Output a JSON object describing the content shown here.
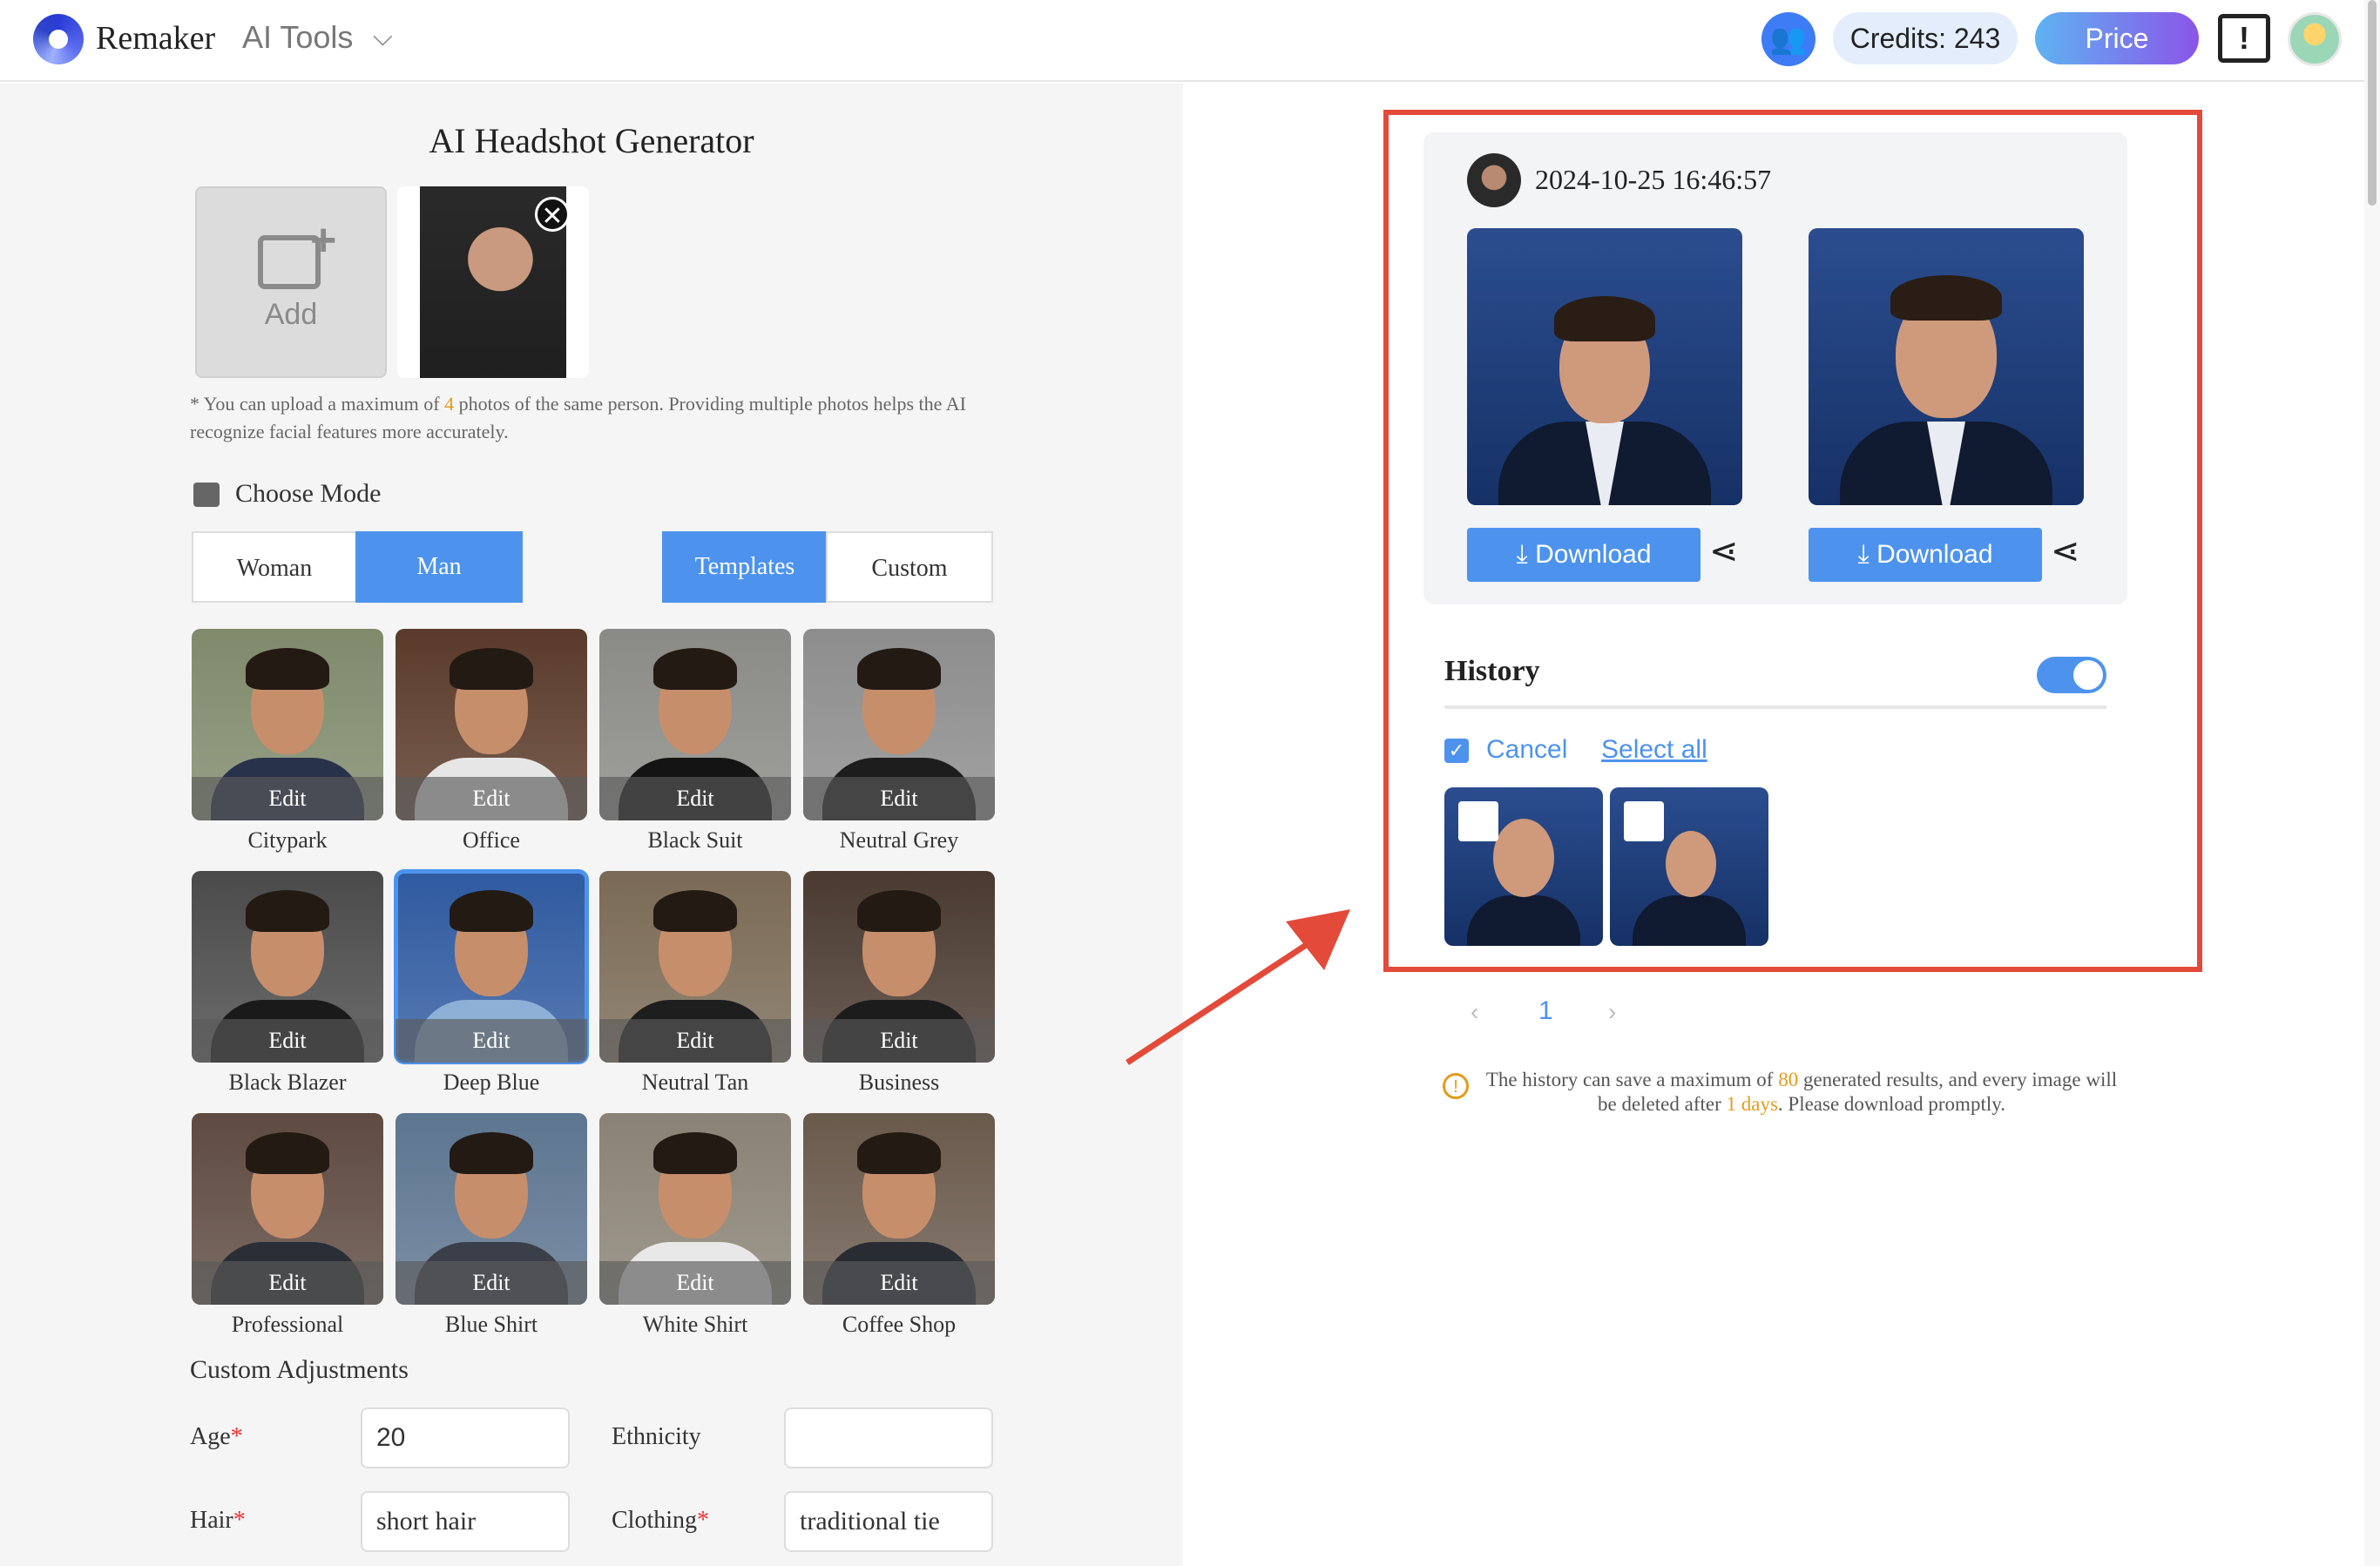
{
  "header": {
    "brand": "Remaker",
    "menu_label": "AI Tools",
    "chevron": "⌵",
    "credits": "Credits: 243",
    "price_label": "Price",
    "feedback_glyph": "!",
    "community_glyph": "👥"
  },
  "generator": {
    "title": "AI Headshot Generator",
    "add_label": "Add",
    "remove_glyph": "✕",
    "hint_prefix": "* You can upload a maximum of ",
    "hint_count": "4",
    "hint_suffix": " photos of the same person. Providing multiple photos helps the AI recognize facial features more accurately.",
    "mode_label": "Choose Mode",
    "gender": {
      "woman": "Woman",
      "man": "Man",
      "selected": "Man"
    },
    "style_tabs": {
      "templates": "Templates",
      "custom": "Custom",
      "selected": "Templates"
    },
    "edit_label": "Edit",
    "templates": [
      {
        "name": "Citypark",
        "bg": "#7f8a6b",
        "suit": "#28324a"
      },
      {
        "name": "Office",
        "bg": "#5a3a2a",
        "suit": "#e6e6e6"
      },
      {
        "name": "Black Suit",
        "bg": "#8a8a86",
        "suit": "#141414"
      },
      {
        "name": "Neutral Grey",
        "bg": "#8d8d8d",
        "suit": "#1d1d1d"
      },
      {
        "name": "Black Blazer",
        "bg": "#4a4a4a",
        "suit": "#1a1a1a"
      },
      {
        "name": "Deep Blue",
        "bg": "#2f5aa0",
        "suit": "#8eb0d6"
      },
      {
        "name": "Neutral Tan",
        "bg": "#7a6a55",
        "suit": "#1e1e1e"
      },
      {
        "name": "Business",
        "bg": "#4a3a30",
        "suit": "#1c1c1c"
      },
      {
        "name": "Professional",
        "bg": "#5e4a40",
        "suit": "#2a2e36"
      },
      {
        "name": "Blue Shirt",
        "bg": "#5d7590",
        "suit": "#3a3f4a"
      },
      {
        "name": "White Shirt",
        "bg": "#8a8274",
        "suit": "#e8e8e8"
      },
      {
        "name": "Coffee Shop",
        "bg": "#6a5a4c",
        "suit": "#2a2c34"
      }
    ],
    "selected_template": "Deep Blue",
    "adjustments_title": "Custom Adjustments",
    "fields": {
      "age_label": "Age",
      "age_value": "20",
      "ethnicity_label": "Ethnicity",
      "ethnicity_value": "",
      "hair_label": "Hair",
      "hair_value": "short hair",
      "clothing_label": "Clothing",
      "clothing_value": "traditional tie",
      "required_mark": "*"
    }
  },
  "result": {
    "timestamp": "2024-10-25 16:46:57",
    "download_label": "Download",
    "download_glyph": "⤓",
    "share_glyph": "⋖"
  },
  "history": {
    "title": "History",
    "toggle_on": true,
    "check_glyph": "✓",
    "cancel_label": "Cancel",
    "select_all_label": "Select all",
    "thumb_count": 2
  },
  "pagination": {
    "prev": "‹",
    "page": "1",
    "next": "›"
  },
  "notice": {
    "icon": "!",
    "prefix": "The history can save a maximum of ",
    "max_results": "80",
    "middle": " generated results, and every image will be deleted after ",
    "days": "1 days",
    "suffix": ". Please download promptly."
  },
  "colors": {
    "accent": "#4d93ee",
    "annotation": "#e34a3a",
    "highlight": "#e49b1a"
  }
}
